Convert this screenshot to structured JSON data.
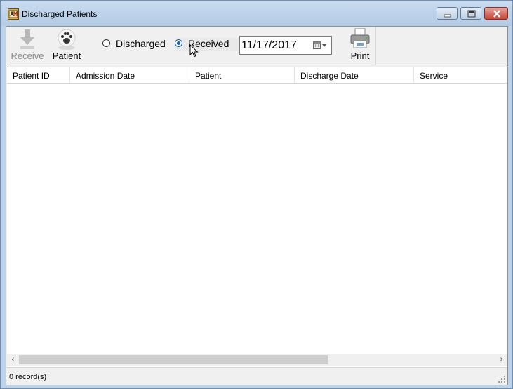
{
  "window": {
    "title": "Discharged Patients",
    "icons": {
      "app": "app-icon",
      "minimize": "minimize-icon",
      "maximize": "maximize-icon",
      "close": "close-icon"
    }
  },
  "toolbar": {
    "receive_label": "Receive",
    "receive_enabled": false,
    "patient_label": "Patient",
    "print_label": "Print",
    "filter": {
      "discharged_label": "Discharged",
      "received_label": "Received",
      "selected": "Received"
    },
    "date_value": "11/17/2017"
  },
  "grid": {
    "columns": [
      "Patient ID",
      "Admission Date",
      "Patient",
      "Discharge Date",
      "Service"
    ],
    "rows": []
  },
  "scrollbar": {
    "left_arrow": "‹",
    "right_arrow": "›"
  },
  "status": {
    "records_text": "0 record(s)"
  },
  "colors": {
    "title_bar": "#bcd3ea",
    "close_button": "#c5473a",
    "radio_selected": "#1a5fb4"
  }
}
